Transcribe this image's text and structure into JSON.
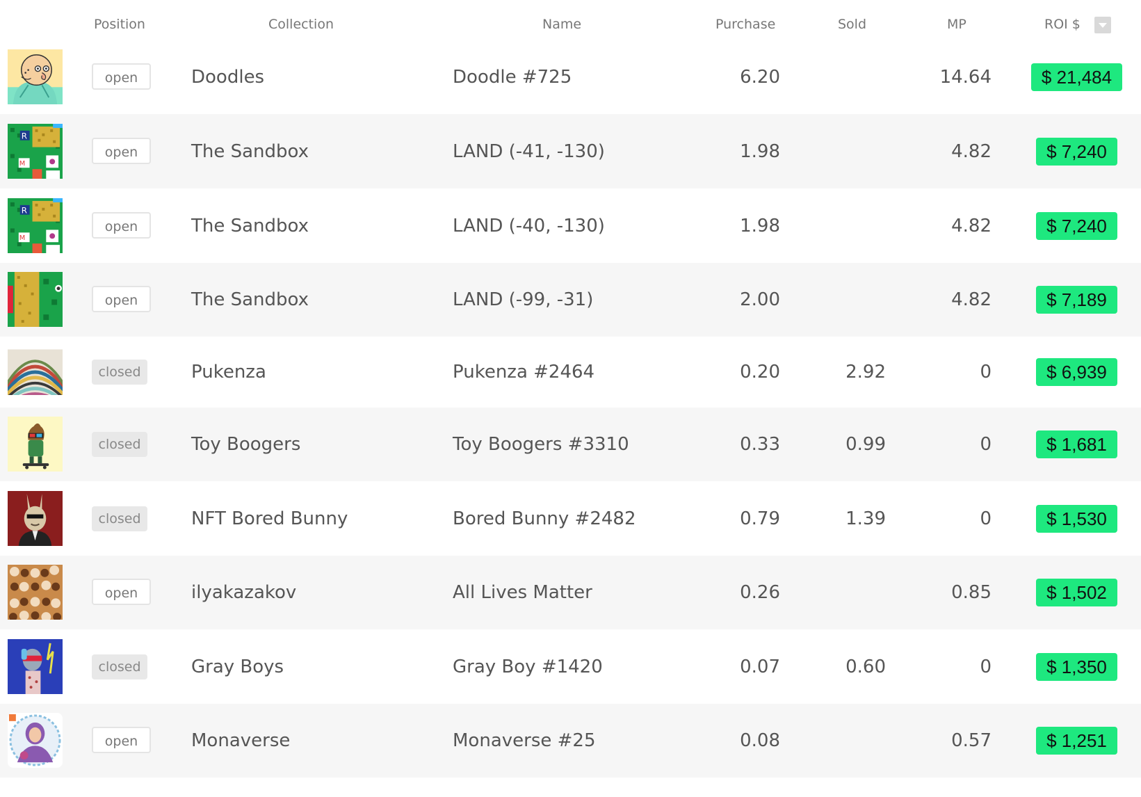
{
  "header": {
    "position": "Position",
    "collection": "Collection",
    "name": "Name",
    "purchase": "Purchase",
    "sold": "Sold",
    "mp": "MP",
    "roi": "ROI $"
  },
  "colors": {
    "roi_badge": "#1ee87f",
    "row_alt": "#f6f6f6",
    "closed_badge": "#e8e8e8"
  },
  "rows": [
    {
      "thumb": "doodle-cartoon-thumbnail",
      "position": "open",
      "collection": "Doodles",
      "name": "Doodle #725",
      "purchase": "6.20",
      "sold": "",
      "mp": "14.64",
      "roi": "$ 21,484"
    },
    {
      "thumb": "sandbox-land-thumbnail",
      "position": "open",
      "collection": "The Sandbox",
      "name": "LAND (-41, -130)",
      "purchase": "1.98",
      "sold": "",
      "mp": "4.82",
      "roi": "$ 7,240"
    },
    {
      "thumb": "sandbox-land-thumbnail",
      "position": "open",
      "collection": "The Sandbox",
      "name": "LAND (-40, -130)",
      "purchase": "1.98",
      "sold": "",
      "mp": "4.82",
      "roi": "$ 7,240"
    },
    {
      "thumb": "sandbox-land-thumbnail",
      "position": "open",
      "collection": "The Sandbox",
      "name": "LAND (-99, -31)",
      "purchase": "2.00",
      "sold": "",
      "mp": "4.82",
      "roi": "$ 7,189"
    },
    {
      "thumb": "pukenza-swirl-thumbnail",
      "position": "closed",
      "collection": "Pukenza",
      "name": "Pukenza #2464",
      "purchase": "0.20",
      "sold": "2.92",
      "mp": "0",
      "roi": "$ 6,939"
    },
    {
      "thumb": "toy-booger-thumbnail",
      "position": "closed",
      "collection": "Toy Boogers",
      "name": "Toy Boogers #3310",
      "purchase": "0.33",
      "sold": "0.99",
      "mp": "0",
      "roi": "$ 1,681"
    },
    {
      "thumb": "bored-bunny-thumbnail",
      "position": "closed",
      "collection": "NFT Bored Bunny",
      "name": "Bored Bunny #2482",
      "purchase": "0.79",
      "sold": "1.39",
      "mp": "0",
      "roi": "$ 1,530"
    },
    {
      "thumb": "all-lives-matter-thumbnail",
      "position": "open",
      "collection": "ilyakazakov",
      "name": "All Lives Matter",
      "purchase": "0.26",
      "sold": "",
      "mp": "0.85",
      "roi": "$ 1,502"
    },
    {
      "thumb": "gray-boy-thumbnail",
      "position": "closed",
      "collection": "Gray Boys",
      "name": "Gray Boy #1420",
      "purchase": "0.07",
      "sold": "0.60",
      "mp": "0",
      "roi": "$ 1,350"
    },
    {
      "thumb": "monaverse-thumbnail",
      "position": "open",
      "collection": "Monaverse",
      "name": "Monaverse #25",
      "purchase": "0.08",
      "sold": "",
      "mp": "0.57",
      "roi": "$ 1,251"
    }
  ]
}
